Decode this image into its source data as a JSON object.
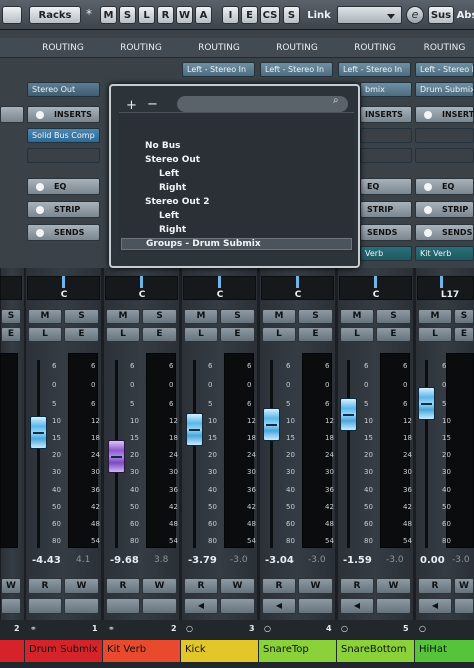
{
  "toolbar": {
    "racks": "Racks",
    "star": "*",
    "buttons": [
      "M",
      "S",
      "L",
      "R",
      "W",
      "A"
    ],
    "buttons2": [
      "I",
      "E",
      "CS",
      "S"
    ],
    "link": "Link",
    "e_icon": "e",
    "sus": "Sus",
    "abs": "Abs"
  },
  "routing": {
    "header": "ROUTING",
    "slots_top": [
      "Left - Stereo In",
      "Left - Stereo In",
      "Left - Stereo In",
      "Left - Stereo In"
    ],
    "stereo_out": "Stereo Out",
    "drum_submix": "Drum Submix",
    "drum_submix2": "Drum Submix",
    "bmix": "bmix"
  },
  "panels": {
    "inserts": "INSERTS",
    "solid_bus": "Solid Bus Comp",
    "eq": "EQ",
    "strip": "STRIP",
    "sends": "SENDS",
    "send_slot": "Kit Verb",
    "send_slot2": "Verb"
  },
  "popup": {
    "plus": "+",
    "minus": "−",
    "options": [
      {
        "label": "No Bus",
        "level": 0
      },
      {
        "label": "Stereo Out",
        "level": 0
      },
      {
        "label": "Left",
        "level": 1
      },
      {
        "label": "Right",
        "level": 1
      },
      {
        "label": "Stereo Out 2",
        "level": 0
      },
      {
        "label": "Left",
        "level": 1
      },
      {
        "label": "Right",
        "level": 1
      },
      {
        "label": "Groups - Drum Submix",
        "level": 0,
        "selected": true
      }
    ]
  },
  "channels": [
    {
      "name": "",
      "number": "2",
      "pan": "C",
      "value": "",
      "peak": "",
      "color": "#d6232a"
    },
    {
      "name": "Drum Submix",
      "number": "1",
      "pan": "C",
      "value": "-4.43",
      "peak": "4.1",
      "color": "#d6232a"
    },
    {
      "name": "Kit Verb",
      "number": "2",
      "pan": "C",
      "value": "-9.68",
      "peak": "3.8",
      "color": "#e94a2e"
    },
    {
      "name": "Kick",
      "number": "3",
      "pan": "C",
      "value": "-3.79",
      "peak": "-3.0",
      "color": "#e3c72a"
    },
    {
      "name": "SnareTop",
      "number": "4",
      "pan": "C",
      "value": "-3.04",
      "peak": "-3.0",
      "color": "#8bd13a"
    },
    {
      "name": "SnareBottom",
      "number": "5",
      "pan": "C",
      "value": "-1.59",
      "peak": "-3.0",
      "color": "#8bd13a"
    },
    {
      "name": "HiHat",
      "number": "",
      "pan": "L17",
      "value": "0.00",
      "peak": "-3.0",
      "color": "#55c43a"
    }
  ],
  "meter_scale": [
    "6",
    "0",
    "5",
    "10",
    "15",
    "20",
    "30",
    "40",
    "50",
    "60",
    "80"
  ],
  "meter_scale_right": [
    "6",
    "0",
    "6",
    "12",
    "18",
    "24",
    "30",
    "36",
    "42",
    "48",
    "54"
  ],
  "ms": {
    "m": "M",
    "s": "S",
    "l": "L",
    "e": "E",
    "r": "R",
    "w": "W"
  }
}
